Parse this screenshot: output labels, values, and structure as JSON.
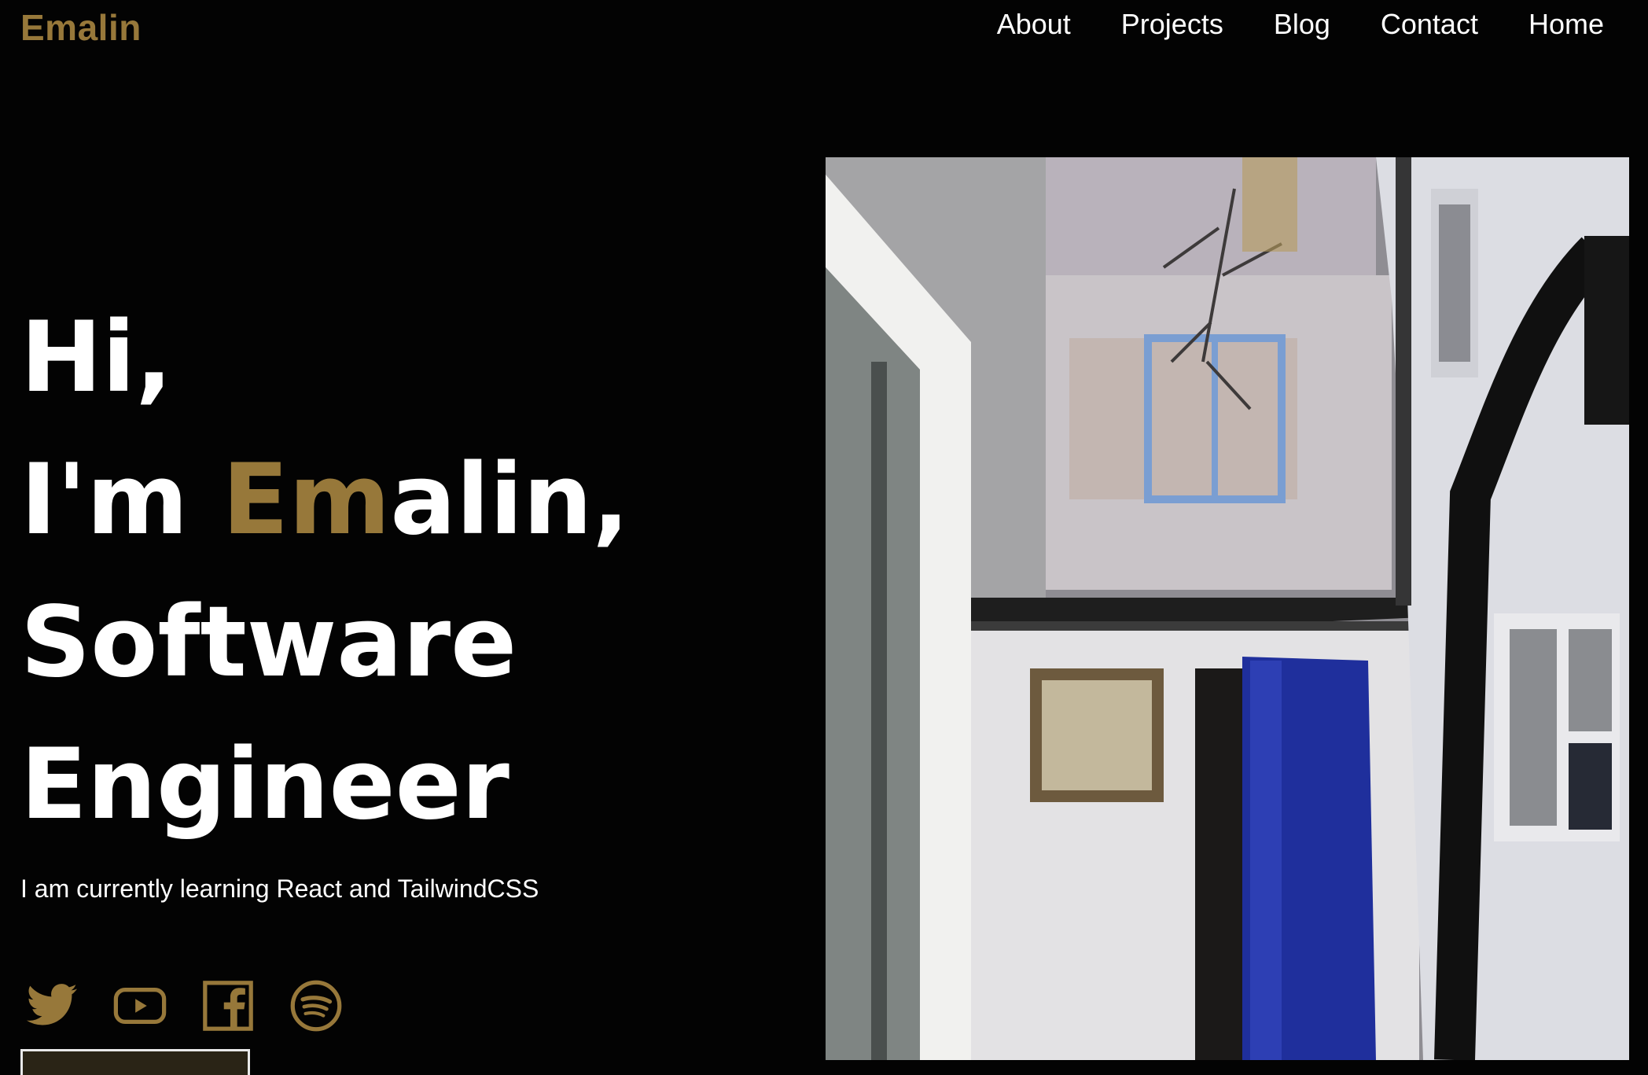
{
  "brand": {
    "name": "Emalin"
  },
  "nav": {
    "items": [
      "About",
      "Projects",
      "Blog",
      "Contact",
      "Home"
    ]
  },
  "hero": {
    "line1": "Hi,",
    "line2_prefix": "I'm ",
    "line2_highlight": "Em",
    "line2_suffix": "alin,",
    "line3": "Software",
    "line4": "Engineer",
    "tagline": "I am currently learning React and TailwindCSS"
  },
  "social": {
    "icons": [
      "twitter-icon",
      "youtube-icon",
      "facebook-icon",
      "spotify-icon"
    ]
  },
  "colors": {
    "accent": "#97783a",
    "background": "#030303",
    "text": "#ffffff"
  }
}
